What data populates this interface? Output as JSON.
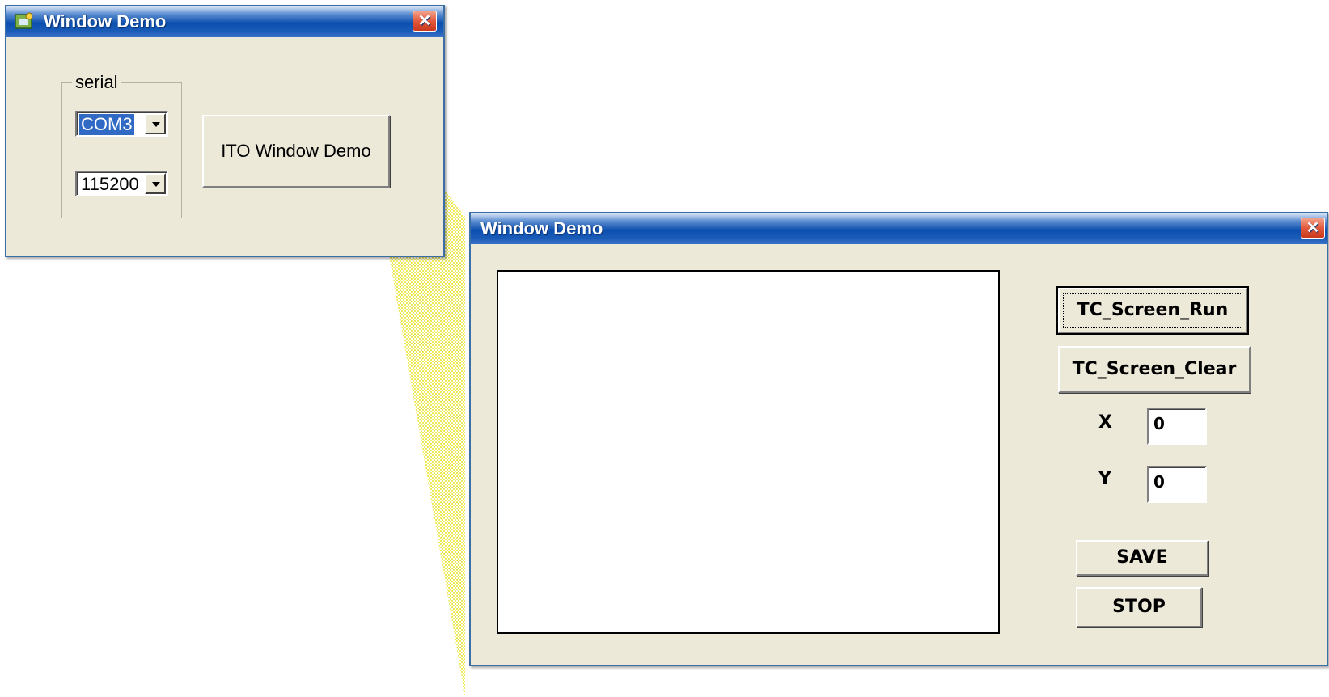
{
  "small_window": {
    "title": "Window Demo",
    "close_glyph": "✕",
    "icon": "app-icon",
    "group_label": "serial",
    "port_combo": {
      "value": "COM3"
    },
    "baud_combo": {
      "value": "115200"
    },
    "open_button_label": "ITO Window Demo"
  },
  "large_window": {
    "title": "Window Demo",
    "close_glyph": "✕",
    "run_button_label": "TC_Screen_Run",
    "clear_button_label": "TC_Screen_Clear",
    "x_label": "X",
    "x_value": "0",
    "y_label": "Y",
    "y_value": "0",
    "save_button_label": "SAVE",
    "stop_button_label": "STOP"
  },
  "colors": {
    "titlebar_blue": "#0b4fae",
    "dialog_bg": "#ECE9D8",
    "selection": "#316ac5",
    "zoom_band": "#f2f07a"
  }
}
